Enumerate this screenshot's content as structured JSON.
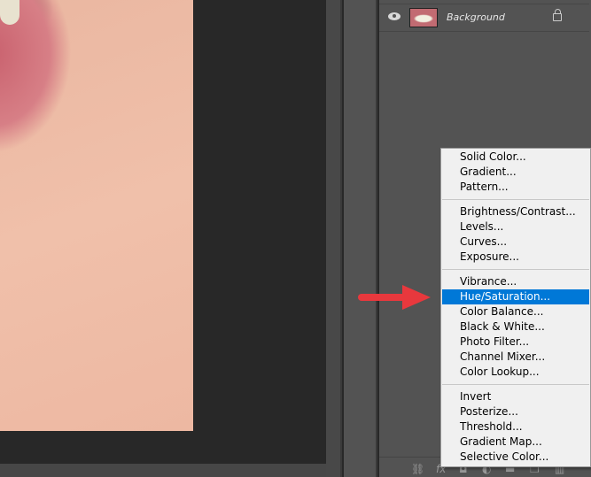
{
  "layers": {
    "items": [
      {
        "name": "Background",
        "visible": true,
        "locked": true
      }
    ]
  },
  "bottom_toolbar": {
    "icons": [
      "link-icon",
      "fx-icon",
      "mask-icon",
      "adjustment-layer-icon",
      "group-icon",
      "new-layer-icon",
      "trash-icon"
    ],
    "fx_label": "fx"
  },
  "adjustment_menu": {
    "groups": [
      [
        "Solid Color...",
        "Gradient...",
        "Pattern..."
      ],
      [
        "Brightness/Contrast...",
        "Levels...",
        "Curves...",
        "Exposure..."
      ],
      [
        "Vibrance...",
        "Hue/Saturation...",
        "Color Balance...",
        "Black & White...",
        "Photo Filter...",
        "Channel Mixer...",
        "Color Lookup..."
      ],
      [
        "Invert",
        "Posterize...",
        "Threshold...",
        "Gradient Map...",
        "Selective Color..."
      ]
    ],
    "highlighted": "Hue/Saturation..."
  },
  "colors": {
    "highlight": "#0078d7",
    "arrow": "#e8383d",
    "panel": "#535353",
    "canvas": "#282828"
  }
}
